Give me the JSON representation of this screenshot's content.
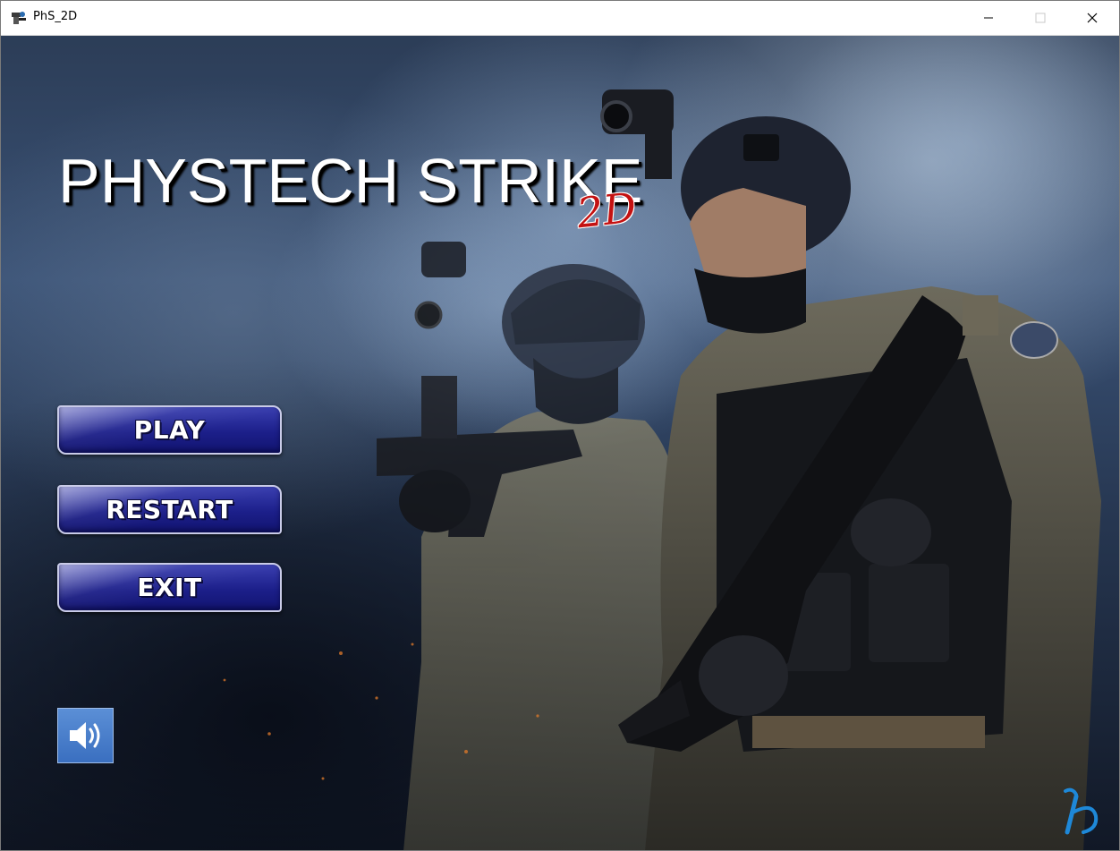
{
  "window": {
    "title": "PhS_2D",
    "icons": {
      "app": "soldier-app-icon",
      "minimize": "minimize-icon",
      "maximize": "maximize-icon",
      "close": "close-icon"
    }
  },
  "game": {
    "title": "PHYSTECH STRIKE",
    "title_suffix": "2D",
    "title_suffix_color": "#c41212"
  },
  "menu": {
    "play": "PLAY",
    "restart": "RESTART",
    "exit": "EXIT",
    "button_color": "#1c1f8a"
  },
  "sound": {
    "icon": "speaker-icon",
    "state": "on",
    "color": "#3a6fc0"
  },
  "branding": {
    "icon": "developer-logo-icon",
    "color": "#1e88d8"
  }
}
